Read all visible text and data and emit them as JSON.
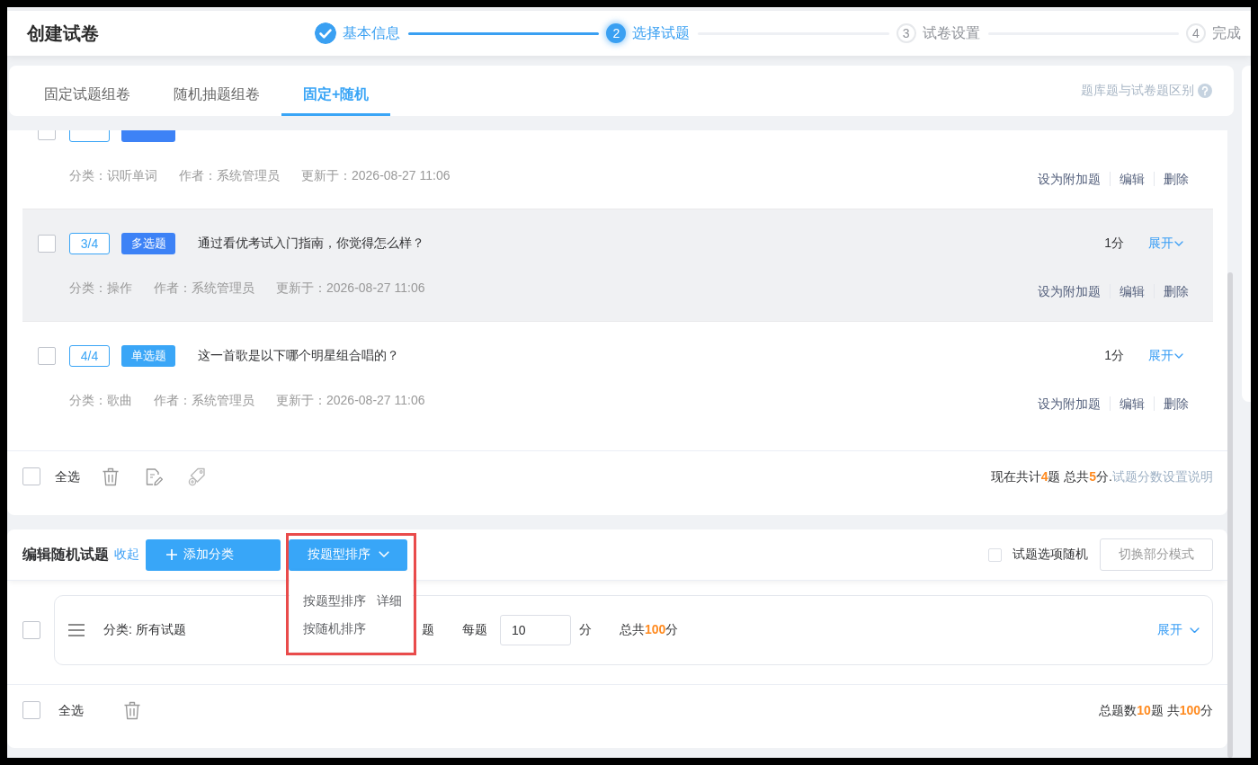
{
  "header": {
    "title": "创建试卷",
    "steps": [
      {
        "label": "基本信息",
        "completed": true,
        "current": false
      },
      {
        "number": "2",
        "label": "选择试题",
        "completed": false,
        "current": true
      },
      {
        "number": "3",
        "label": "试卷设置",
        "completed": false,
        "current": false
      },
      {
        "number": "4",
        "label": "完成",
        "completed": false,
        "current": false
      }
    ]
  },
  "mode_tabs": {
    "tabs": [
      {
        "label": "固定试题组卷",
        "selected": false
      },
      {
        "label": "随机抽题组卷",
        "selected": false
      },
      {
        "label": "固定+随机",
        "selected": true
      }
    ],
    "help_link": "题库题与试卷题区别"
  },
  "fixed_questions": {
    "questions": [
      {
        "checked": false,
        "hovered": false,
        "color": "#3d82f6",
        "category": "分类：识听单词",
        "author": "作者：系统管理员",
        "updated": "更新于：2026-08-27 11:06",
        "actions": [
          "设为附加题",
          "编辑",
          "删除"
        ]
      },
      {
        "checked": false,
        "hovered": true,
        "index": "3/4",
        "type": "多选题",
        "color": "#3d82f6",
        "text": "通过看优考试入门指南，你觉得怎么样？",
        "score": "1分",
        "expand": "展开",
        "category": "分类：操作",
        "author": "作者：系统管理员",
        "updated": "更新于：2026-08-27 11:06",
        "actions": [
          "设为附加题",
          "编辑",
          "删除"
        ]
      },
      {
        "checked": false,
        "hovered": false,
        "index": "4/4",
        "type": "单选题",
        "color": "#3aa6f7",
        "text": "这一首歌是以下哪个明星组合唱的？",
        "score": "1分",
        "expand": "展开",
        "category": "分类：歌曲",
        "author": "作者：系统管理员",
        "updated": "更新于：2026-08-27 11:06",
        "actions": [
          "设为附加题",
          "编辑",
          "删除"
        ]
      }
    ],
    "footer": {
      "select_all": "全选",
      "checked": false,
      "summary": "现在共计**4**题 总共**5**分.",
      "help_link": "试题分数设置说明"
    }
  },
  "random_questions": {
    "title": "编辑随机试题",
    "collapse_link": "收起",
    "add_button": "添加分类",
    "sort_button": "按题型排序",
    "sort_menu": {
      "open": true,
      "items": [
        {
          "label": "按题型排序",
          "extra": "详细"
        },
        {
          "label": "按随机排序"
        }
      ]
    },
    "shuffle_options": {
      "label": "试题选项随机",
      "checked": false
    },
    "switch_button": "切换部分模式",
    "categories": [
      {
        "checked": false,
        "category": "分类: 所有试题",
        "partial_text": "题",
        "per_label": "每题",
        "per_score": "10",
        "unit": "分",
        "total": "总共**100**分",
        "expand": "展开"
      }
    ],
    "footer": {
      "select_all": "全选",
      "checked": false,
      "summary": "总题数**10**题 共**100**分"
    }
  }
}
